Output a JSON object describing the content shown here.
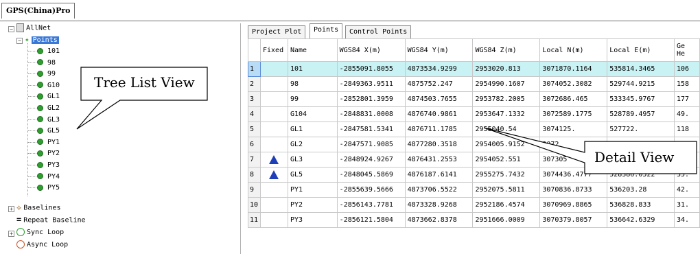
{
  "window_tab": "GPS(China)Pro",
  "tree": {
    "root": "AllNet",
    "points_label": "Points",
    "points": [
      "101",
      "98",
      "99",
      "G104",
      "GL1",
      "GL2",
      "GL3",
      "GL5",
      "PY1",
      "PY2",
      "PY3",
      "PY4",
      "PY5"
    ],
    "points_visible": [
      "101",
      "98",
      "99",
      "G10",
      "GL1",
      "GL2",
      "GL3",
      "GL5",
      "PY1",
      "PY2",
      "PY3",
      "PY4",
      "PY5"
    ],
    "baselines": "Baselines",
    "repeat_baseline": "Repeat Baseline",
    "sync_loop": "Sync Loop",
    "async_loop": "Async Loop"
  },
  "tabs": [
    "Project Plot",
    "Points",
    "Control Points"
  ],
  "active_tab": "Points",
  "columns": [
    "",
    "Fixed",
    "Name",
    "WGS84 X(m)",
    "WGS84 Y(m)",
    "WGS84 Z(m)",
    "Local N(m)",
    "Local E(m)",
    "Ge He"
  ],
  "column_last_lines": [
    "Ge",
    "He"
  ],
  "rows": [
    {
      "n": "1",
      "fixed": false,
      "name": "101",
      "x": "-2855091.8055",
      "y": "4873534.9299",
      "z": "2953020.813",
      "ln": "3071870.1164",
      "le": "535814.3465",
      "h": "106"
    },
    {
      "n": "2",
      "fixed": false,
      "name": "98",
      "x": "-2849363.9511",
      "y": "4875752.247",
      "z": "2954990.1607",
      "ln": "3074052.3082",
      "le": "529744.9215",
      "h": "158"
    },
    {
      "n": "3",
      "fixed": false,
      "name": "99",
      "x": "-2852801.3959",
      "y": "4874503.7655",
      "z": "2953782.2005",
      "ln": "3072686.465",
      "le": "533345.9767",
      "h": "177"
    },
    {
      "n": "4",
      "fixed": false,
      "name": "G104",
      "x": "-2848831.0008",
      "y": "4876740.9861",
      "z": "2953647.1332",
      "ln": "3072589.1775",
      "le": "528789.4957",
      "h": "49."
    },
    {
      "n": "5",
      "fixed": false,
      "name": "GL1",
      "x": "-2847581.5341",
      "y": "4876711.1785",
      "z": "2955040.54",
      "ln": "3074125.",
      "le": "527722.",
      "h": "118"
    },
    {
      "n": "6",
      "fixed": false,
      "name": "GL2",
      "x": "-2847571.9085",
      "y": "4877280.3518",
      "z": "2954005.9152",
      "ln": "3072",
      "le": "",
      "h": ""
    },
    {
      "n": "7",
      "fixed": true,
      "name": "GL3",
      "x": "-2848924.9267",
      "y": "4876431.2553",
      "z": "2954052.551",
      "ln": "307305",
      "le": "",
      "h": ""
    },
    {
      "n": "8",
      "fixed": true,
      "name": "GL5",
      "x": "-2848045.5869",
      "y": "4876187.6141",
      "z": "2955275.7432",
      "ln": "3074436.4777",
      "le": "528386.0522",
      "h": "35."
    },
    {
      "n": "9",
      "fixed": false,
      "name": "PY1",
      "x": "-2855639.5666",
      "y": "4873706.5522",
      "z": "2952075.5811",
      "ln": "3070836.8733",
      "le": "536203.28",
      "h": "42."
    },
    {
      "n": "10",
      "fixed": false,
      "name": "PY2",
      "x": "-2856143.7781",
      "y": "4873328.9268",
      "z": "2952186.4574",
      "ln": "3070969.8865",
      "le": "536828.833",
      "h": "31."
    },
    {
      "n": "11",
      "fixed": false,
      "name": "PY3",
      "x": "-2856121.5804",
      "y": "4873662.8378",
      "z": "2951666.0009",
      "ln": "3070379.8057",
      "le": "536642.6329",
      "h": "34."
    }
  ],
  "callouts": {
    "tree": "Tree List View",
    "detail": "Detail View"
  },
  "colors": {
    "selected_row": "#c9f2f4",
    "point_dot": "#2e9e2e",
    "fixed_marker": "#1f3fb8",
    "tree_selection": "#3a78d8"
  }
}
